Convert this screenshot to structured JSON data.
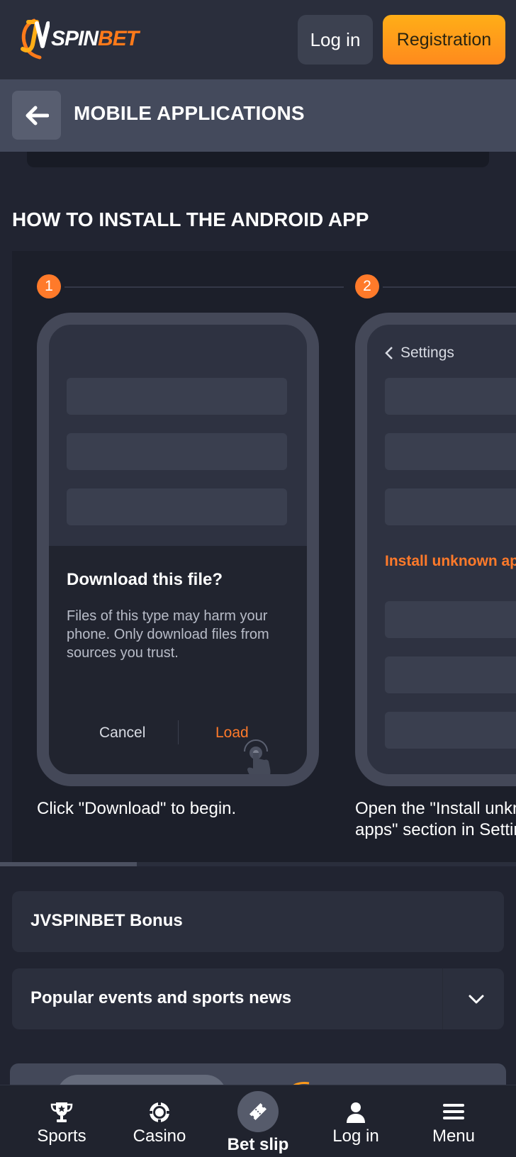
{
  "header": {
    "logo": {
      "mark": "JV",
      "spin": "SPIN",
      "bet": "BET"
    },
    "login_label": "Log in",
    "registration_label": "Registration"
  },
  "subheader": {
    "title": "MOBILE APPLICATIONS"
  },
  "section": {
    "title": "HOW TO INSTALL THE ANDROID APP"
  },
  "steps": [
    {
      "number": "1",
      "dialog_title": "Download this file?",
      "dialog_body": "Files of this type may harm your phone. Only download files from sources you trust.",
      "cancel_label": "Cancel",
      "load_label": "Load",
      "caption": "Click \"Download\" to begin."
    },
    {
      "number": "2",
      "settings_label": "Settings",
      "install_label": "Install unknown apps",
      "caption_line1": "Open the \"Install unknown",
      "caption_line2": "apps\" section in Settings."
    }
  ],
  "carousel_scroll": {
    "position_fraction": 0.0
  },
  "accordions": [
    {
      "label": "JVSPINBET Bonus"
    },
    {
      "label": "Popular events and sports news",
      "expandable": true
    }
  ],
  "bottom_nav": {
    "items": [
      {
        "label": "Sports",
        "icon": "trophy-icon"
      },
      {
        "label": "Casino",
        "icon": "casino-chip-icon"
      },
      {
        "label": "Bet slip",
        "icon": "ticket-icon"
      },
      {
        "label": "Log in",
        "icon": "user-icon"
      },
      {
        "label": "Menu",
        "icon": "hamburger-icon"
      }
    ]
  },
  "colors": {
    "accent": "#ff7a2a",
    "registration_gradient_top": "#ffae17",
    "registration_gradient_bottom": "#ff8a1d",
    "background": "#212431"
  }
}
